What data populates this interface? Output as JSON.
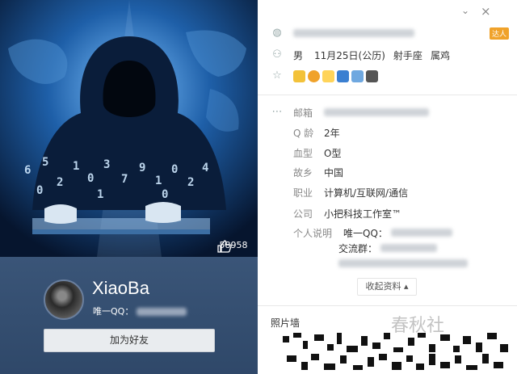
{
  "profile": {
    "nickname": "XiaoBa",
    "qq_prefix": "唯一QQ：",
    "likes": "58958",
    "add_friend_label": "加为好友"
  },
  "window": {
    "minimize": "⌄",
    "close": "×"
  },
  "info": {
    "vip_tag": "达人",
    "gender": "男",
    "birthday": "11月25日(公历)",
    "zodiac": "射手座",
    "animal": "属鸡",
    "email_label": "邮箱",
    "qage_label": "Q 龄",
    "qage": "2年",
    "blood_label": "血型",
    "blood": "O型",
    "hometown_label": "故乡",
    "hometown": "中国",
    "job_label": "职业",
    "job": "计算机/互联网/通信",
    "company_label": "公司",
    "company": "小把科技工作室™",
    "bio_label": "个人说明",
    "bio_line1": "唯一QQ：",
    "bio_line2": "交流群：",
    "collapse_label": "收起资料 ▴",
    "photo_wall_label": "照片墙",
    "watermark": "春秋社"
  },
  "colors": {
    "left_bg": "#2d4a6f",
    "button_bg": "#e9ecef",
    "accent": "#f0a22a"
  }
}
